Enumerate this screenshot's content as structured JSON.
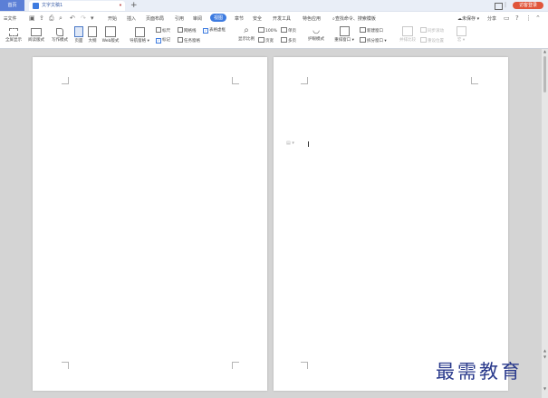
{
  "titlebar": {
    "home_tab": "首页",
    "doc_tab": "文字文稿1",
    "doc_tab_close": "•",
    "new_tab": "+",
    "login": "访客登录"
  },
  "menu": {
    "file": "文件",
    "items": [
      "开始",
      "插入",
      "页面布局",
      "引用",
      "审阅",
      "视图",
      "章节",
      "安全",
      "开发工具",
      "特色应用"
    ],
    "active_index": 5,
    "search": "查找命令、搜索模板",
    "right": {
      "unsaved": "未保存",
      "share": "分享"
    }
  },
  "ribbon": {
    "full_screen": "全屏显示",
    "reading_mode": "阅读版式",
    "write_mode": "写作模式",
    "page_view": "页面",
    "outline": "大纲",
    "web_view": "Web版式",
    "nav_pane": "导航窗格",
    "ruler": "标尺",
    "grid": "网格线",
    "table_grid": "表格虚框",
    "markup": "标记",
    "task_pane": "任务窗格",
    "zoom": "显示比例",
    "zoom_100": "100%",
    "single_page": "单页",
    "page_width": "页宽",
    "multi_page": "多页",
    "eye_mode": "护眼模式",
    "rearrange": "重排窗口",
    "new_window": "新建窗口",
    "split_window": "拆分窗口",
    "side_by_side": "并排比较",
    "sync_scroll": "同步滚动",
    "reset_pos": "重设位置",
    "macro": "宏"
  },
  "colors": {
    "accent": "#3d7be0",
    "home_tab": "#5b7fd6",
    "login": "#e0553b",
    "workspace": "#d4d4d4",
    "watermark": "#2a3a8c"
  },
  "watermark": "最需教育"
}
